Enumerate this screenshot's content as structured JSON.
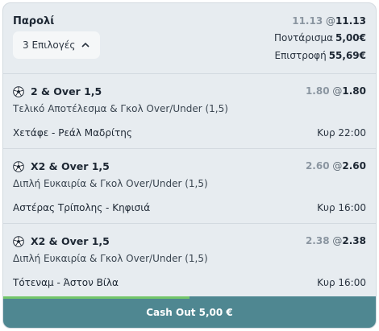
{
  "slip": {
    "title": "Παρολί",
    "selections_button": "3 Επιλογές",
    "odds_old": "11.13",
    "odds_at": "@",
    "odds_new": "11.13",
    "stake_label": "Ποντάρισμα",
    "stake_value": "5,00€",
    "return_label": "Επιστροφή",
    "return_value": "55,69€"
  },
  "selections": [
    {
      "name": "2 & Over 1,5",
      "market": "Τελικό Αποτέλεσμα & Γκολ Over/Under (1,5)",
      "match": "Χετάφε - Ρεάλ Μαδρίτης",
      "time": "Κυρ 22:00",
      "odds_old": "1.80",
      "odds_at": "@",
      "odds_new": "1.80"
    },
    {
      "name": "Χ2 & Over 1,5",
      "market": "Διπλή Ευκαιρία & Γκολ Over/Under (1,5)",
      "match": "Αστέρας Τρίπολης - Κηφισιά",
      "time": "Κυρ 16:00",
      "odds_old": "2.60",
      "odds_at": "@",
      "odds_new": "2.60"
    },
    {
      "name": "Χ2 & Over 1,5",
      "market": "Διπλή Ευκαιρία & Γκολ Over/Under (1,5)",
      "match": "Τότεναμ - Άστον Βίλα",
      "time": "Κυρ 16:00",
      "odds_old": "2.38",
      "odds_at": "@",
      "odds_new": "2.38"
    }
  ],
  "cashout": {
    "label": "Cash Out 5,00 €",
    "progress_fraction": 0.5,
    "button_color": "#4f8791",
    "progress_color": "#73c66b"
  },
  "icons": {
    "selection": "soccer-ball-icon",
    "toggle": "chevron-up-icon"
  }
}
